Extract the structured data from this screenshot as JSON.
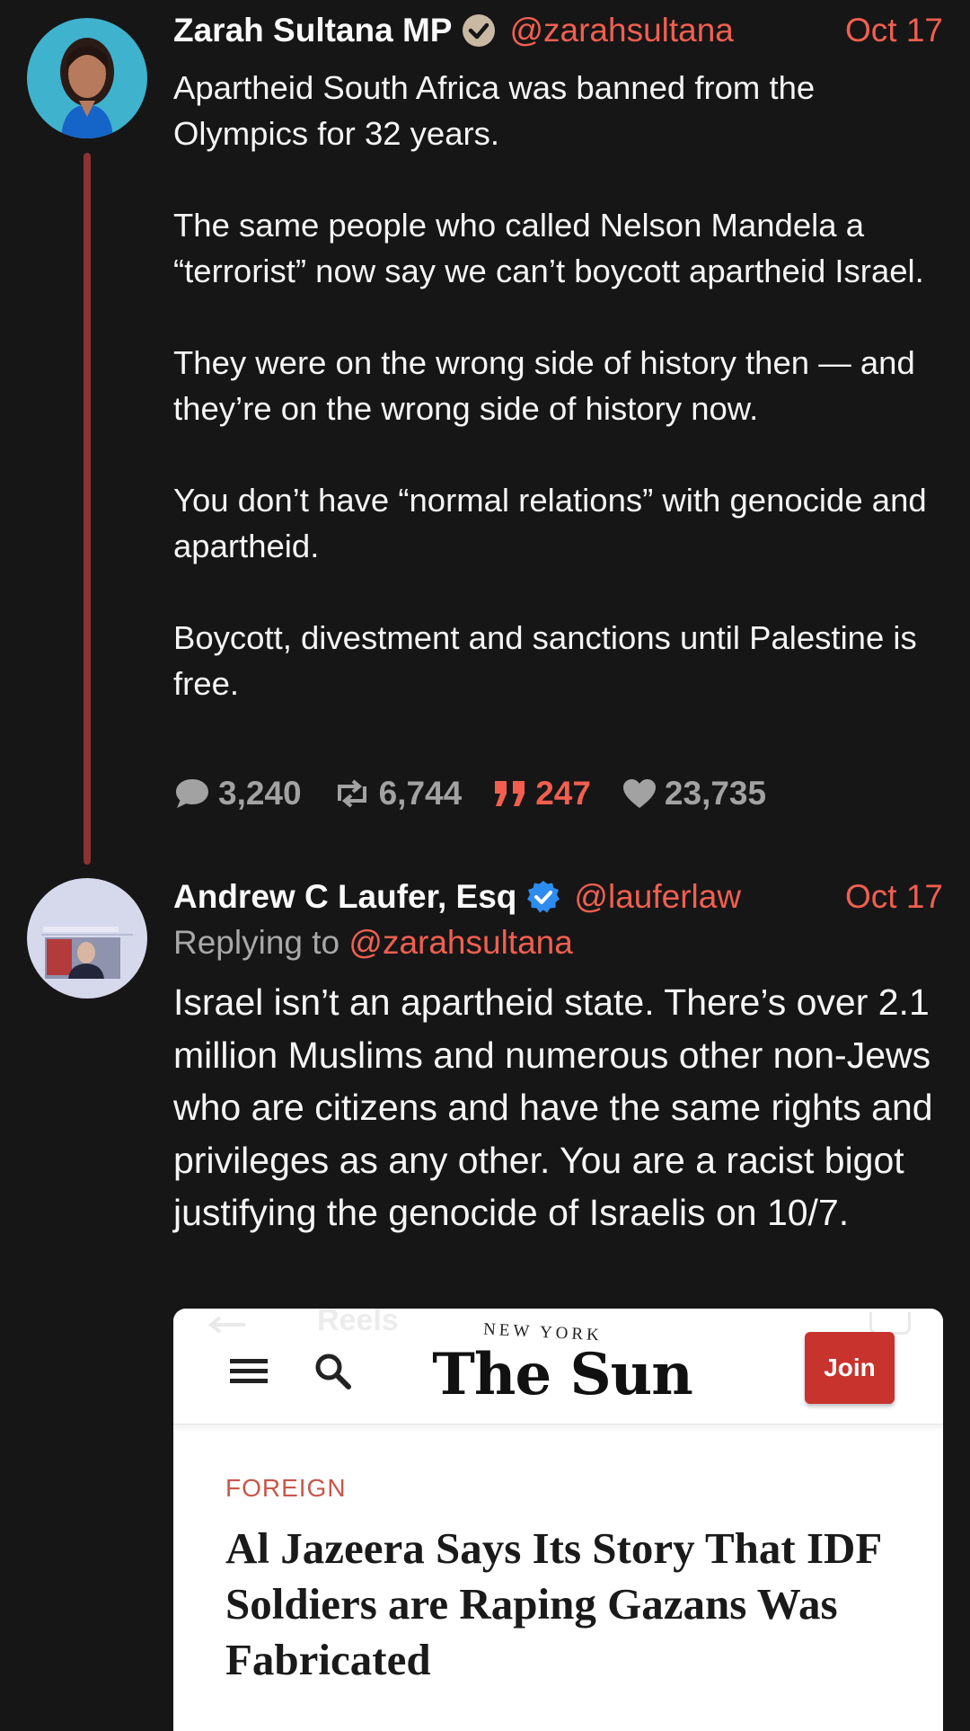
{
  "post1": {
    "display_name": "Zarah Sultana MP",
    "handle": "@zarahsultana",
    "date": "Oct 17",
    "paragraphs": [
      "Apartheid South Africa was banned from the Olympics for 32 years.",
      "The same people who called Nelson Mandela a “terrorist” now say we can’t boycott apartheid Israel.",
      "They were on the wrong side of history then — and they’re on the wrong side of history now.",
      "You don’t have “normal relations” with genocide and apartheid.",
      "Boycott, divestment and sanctions until Palestine is free."
    ],
    "stats": {
      "replies": "3,240",
      "reposts": "6,744",
      "quotes": "247",
      "likes": "23,735"
    }
  },
  "post2": {
    "display_name": "Andrew C Laufer, Esq",
    "handle": "@lauferlaw",
    "date": "Oct 17",
    "replying_prefix": "Replying to",
    "replying_handle": "@zarahsultana",
    "text": "Israel isn’t an apartheid state.  There’s over 2.1 million Muslims and numerous other non-Jews who are citizens and have the same rights and privileges as any other. You are a racist bigot justifying the genocide of Israelis on 10/7."
  },
  "embed": {
    "ghost_label": "Reels",
    "masthead_small": "NEW YORK",
    "masthead": "The Sun",
    "join_label": "Join",
    "kicker": "FOREIGN",
    "headline": "Al Jazeera Says Its Story That IDF Soldiers are Raping Gazans Was Fabricated"
  },
  "colors": {
    "background": "#161617",
    "accent": "#f25f4f",
    "thread_line": "#8b3232",
    "muted": "#a2a2a2",
    "join_button": "#c8332d"
  },
  "icons": {
    "verified_gray": "gray-check-badge-icon",
    "verified_blue": "blue-check-badge-icon",
    "reply": "speech-bubble-icon",
    "repost": "repost-arrows-icon",
    "quote": "quote-marks-icon",
    "like": "heart-icon"
  }
}
